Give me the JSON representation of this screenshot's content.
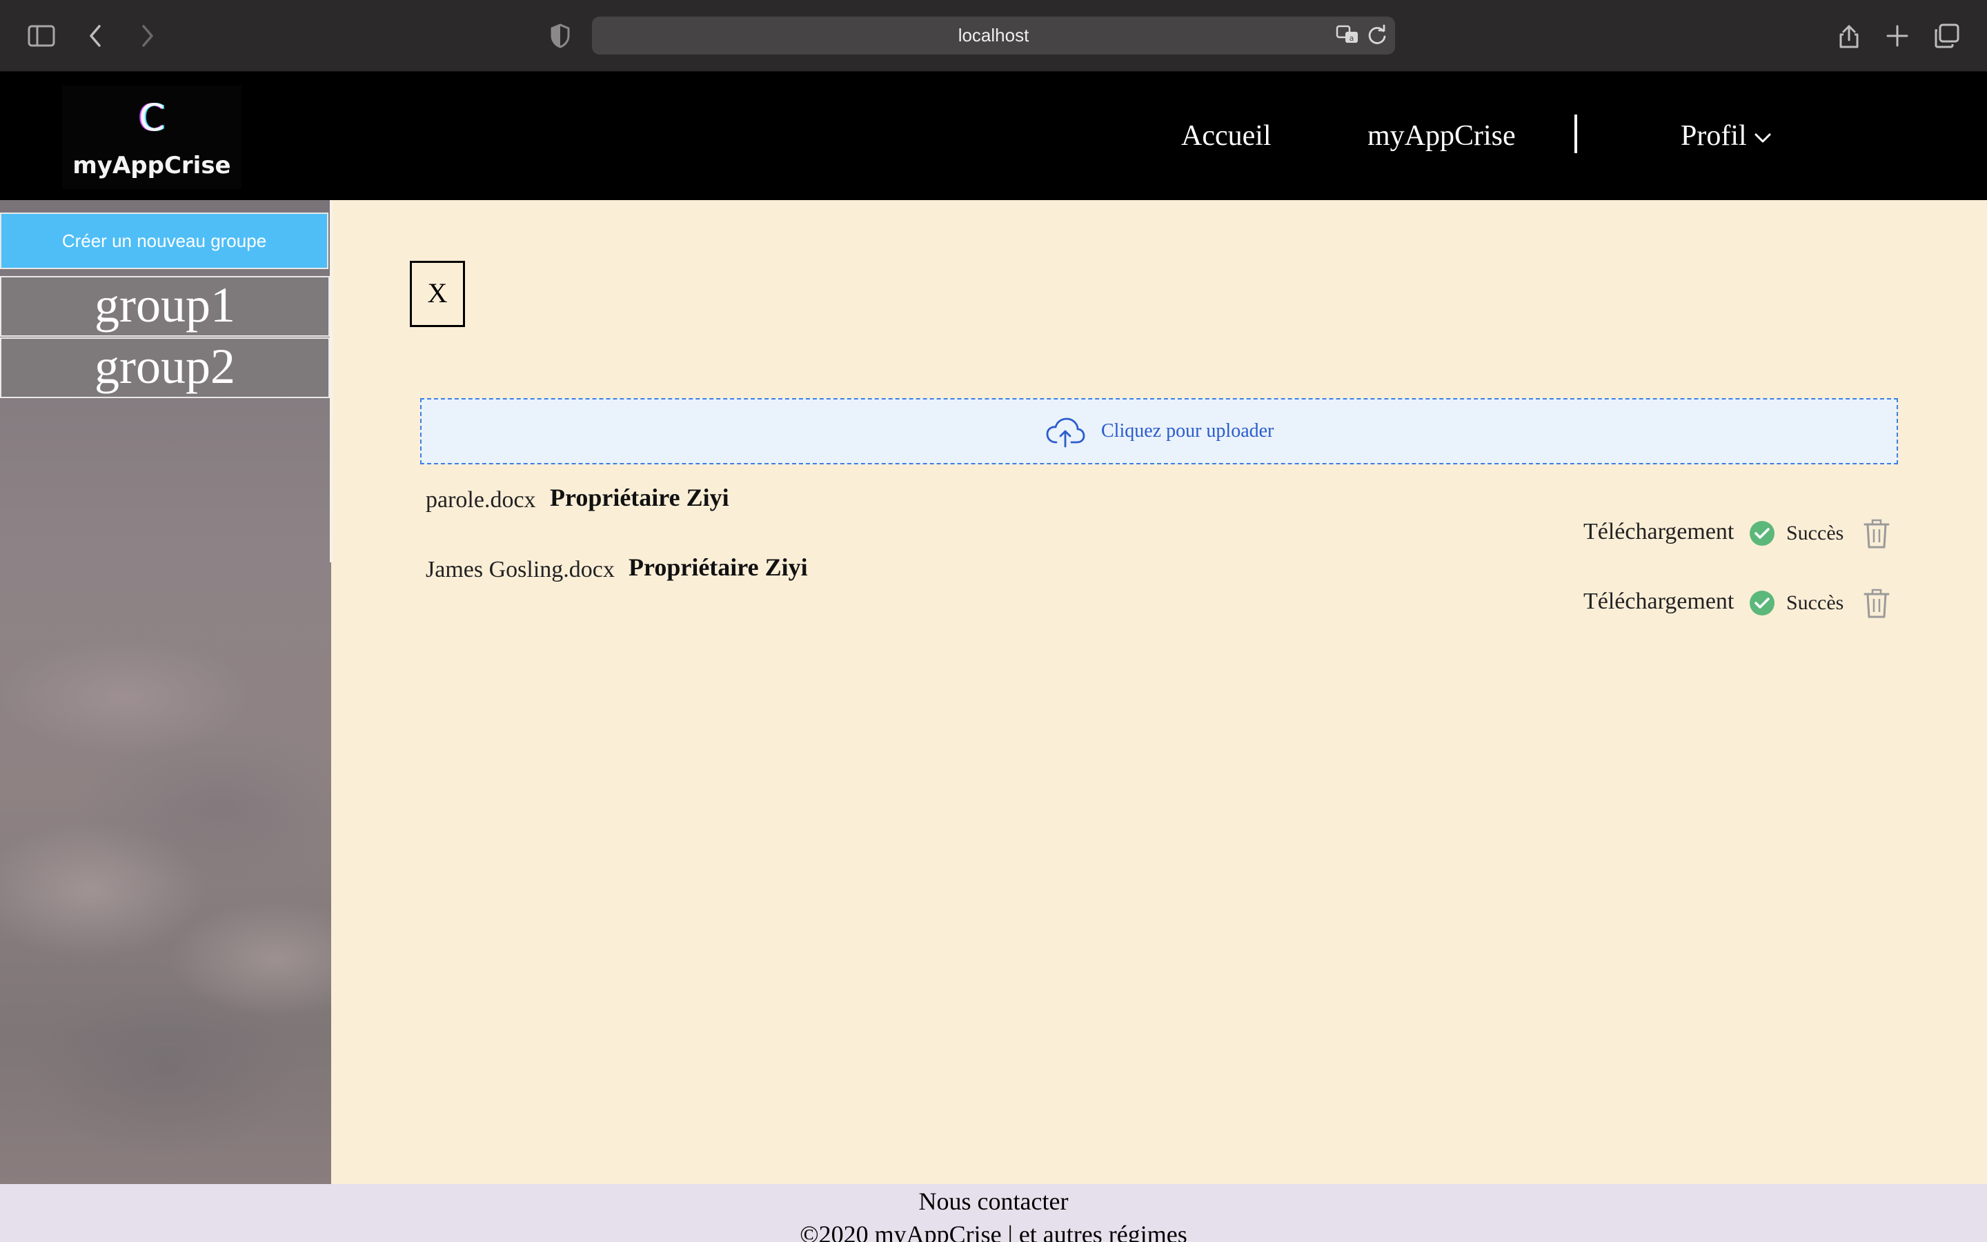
{
  "browser": {
    "url": "localhost"
  },
  "header": {
    "logo_mark": "C",
    "logo_text": "myAppCrise",
    "nav": {
      "home": "Accueil",
      "app": "myAppCrise",
      "profile": "Profil"
    }
  },
  "sidebar": {
    "create_button": "Créer un nouveau groupe",
    "groups": [
      "group1",
      "group2"
    ]
  },
  "main": {
    "close_button": "X",
    "upload_label": "Cliquez pour uploader",
    "files": [
      {
        "name": "parole.docx",
        "owner": "Propriétaire Ziyi",
        "action": "Téléchargement",
        "status": "Succès"
      },
      {
        "name": "James Gosling.docx",
        "owner": "Propriétaire Ziyi",
        "action": "Téléchargement",
        "status": "Succès"
      }
    ]
  },
  "footer": {
    "contact": "Nous contacter",
    "copyright": "©2020 myAppCrise | et autres régimes"
  },
  "colors": {
    "page_bg": "#fbeed7",
    "primary_button": "#4fbef7",
    "success": "#52c41a",
    "link": "#2a5ccc"
  }
}
